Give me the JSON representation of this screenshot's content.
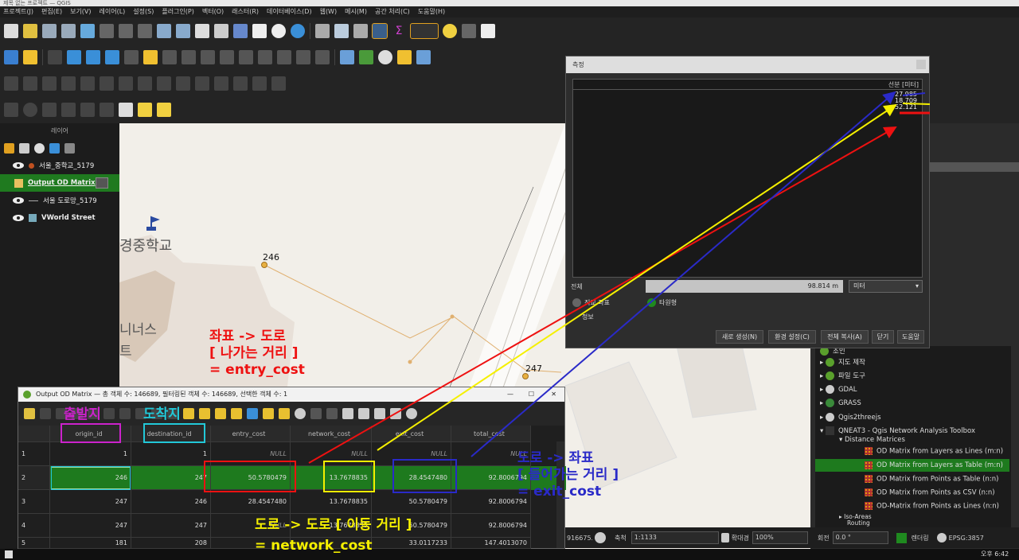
{
  "app": {
    "title": "제목 없는 프로젝트 — QGIS"
  },
  "menu": [
    "프로젝트(J)",
    "편집(E)",
    "보기(V)",
    "레이어(L)",
    "설정(S)",
    "플러그인(P)",
    "벡터(O)",
    "래스터(R)",
    "데이터베이스(D)",
    "웹(W)",
    "메시(M)",
    "공간 처리(C)",
    "도움말(H)"
  ],
  "layers_panel": {
    "title": "레이어",
    "items": [
      {
        "label": "서울_중학교_5179"
      },
      {
        "label": "Output OD Matrix"
      },
      {
        "label": "서울 도로망_5179"
      },
      {
        "label": "VWorld Street"
      }
    ]
  },
  "map": {
    "school_label": "경중학교",
    "partial_label_1": "니너스",
    "partial_label_2": "트",
    "node_a": "246",
    "node_b": "247"
  },
  "measure": {
    "title": "측정",
    "column_header": "선분 [미터]",
    "segments": [
      "27.985",
      "18.709",
      "52.121"
    ],
    "total_label": "전체",
    "total_value": "98.814 m",
    "unit": "미터",
    "radio_cartesian": "직교 좌표",
    "radio_ellipsoidal": "타원형",
    "info_label": "정보",
    "buttons": {
      "new": "새로 생성(N)",
      "config": "환경 설정(C)",
      "copy": "전체 복사(A)",
      "close": "닫기",
      "help": "도움말"
    }
  },
  "processing_tree": {
    "items": [
      "조인",
      "지도 제작",
      "파일 도구",
      "GDAL",
      "GRASS",
      "Qgis2threejs",
      "QNEAT3 - Qgis Network Analysis Toolbox"
    ],
    "group": "Distance Matrices",
    "algorithms": [
      "OD Matrix from Layers as Lines (m:n)",
      "OD Matrix from Layers as Table (m:n)",
      "OD Matrix from Points as Table (n:n)",
      "OD Matrix from Points as CSV (n:n)",
      "OD-Matrix from Points as Lines (n:n)"
    ],
    "more": [
      "Iso-Areas",
      "Routing"
    ]
  },
  "od_window": {
    "title": "Output OD Matrix — 총 객체 수: 146689, 필터링된 객체 수: 146689, 선택한 객체 수: 1",
    "columns": [
      "origin_id",
      "destination_id",
      "entry_cost",
      "network_cost",
      "exit_cost",
      "total_cost"
    ],
    "rows": [
      {
        "num": "1",
        "cells": [
          "1",
          "1",
          "NULL",
          "NULL",
          "NULL",
          "NULL"
        ]
      },
      {
        "num": "2",
        "cells": [
          "246",
          "247",
          "50.5780479",
          "13.7678835",
          "28.4547480",
          "92.8006794"
        ]
      },
      {
        "num": "3",
        "cells": [
          "247",
          "246",
          "28.4547480",
          "13.7678835",
          "50.5780479",
          "92.8006794"
        ]
      },
      {
        "num": "4",
        "cells": [
          "247",
          "247",
          "NULL",
          "13.7678835",
          "50.5780479",
          "92.8006794"
        ]
      },
      {
        "num": "5",
        "cells": [
          "181",
          "208",
          "",
          "",
          "33.0117233",
          "147.4013070"
        ]
      }
    ]
  },
  "statusbar": {
    "coordinate": "916675.9",
    "scale_label": "축척",
    "scale": "1:1133",
    "magnifier_label": "확대경",
    "magnifier": "100%",
    "rotation_label": "회전",
    "rotation": "0.0 °",
    "render": "렌더링",
    "crs": "EPSG:3857"
  },
  "taskbar": {
    "time": "오후 6:42"
  },
  "annotations": {
    "entry_1": "좌표 -> 도로",
    "entry_2": "[ 나가는 거리 ]",
    "entry_3": "= entry_cost",
    "exit_1": "도로 -> 좌표",
    "exit_2": "[ 들어가는 거리 ]",
    "exit_3": "= exit_cost",
    "net_1": "도로 -> 도로 [ 이동 거리 ]",
    "net_2": "= network_cost",
    "origin": "출발지",
    "destination": "도착지"
  },
  "colors": {
    "selected_row": "#1e7a1e",
    "annotation_red": "#ee1111",
    "annotation_yellow": "#f5f000",
    "annotation_blue": "#2a2ac8",
    "annotation_magenta": "#cc22cc",
    "annotation_cyan": "#22c8d8"
  }
}
